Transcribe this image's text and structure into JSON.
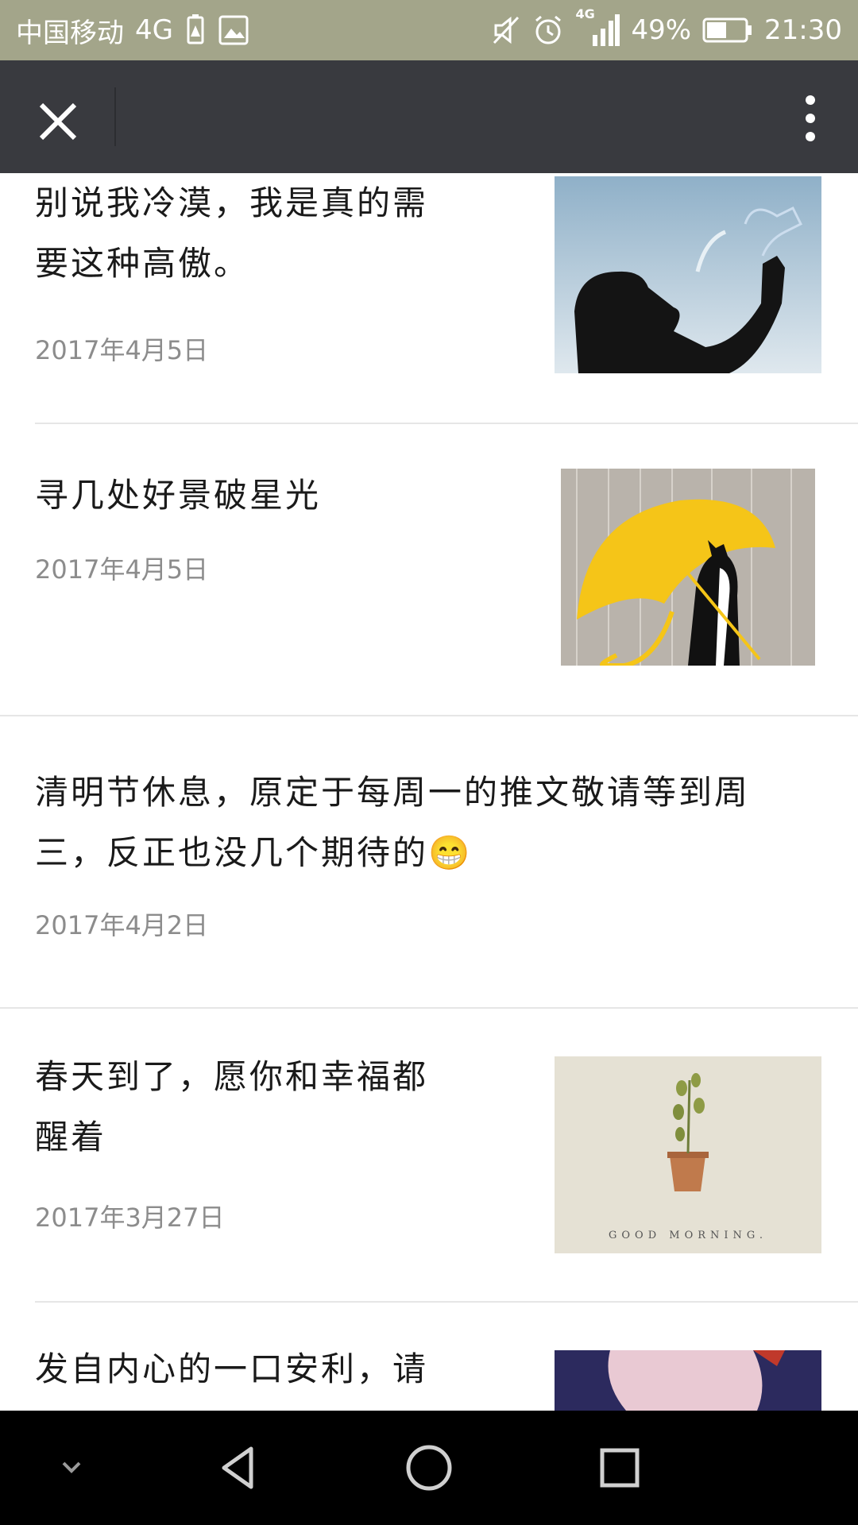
{
  "status_bar": {
    "carrier": "中国移动",
    "network": "4G",
    "signal_label": "4G",
    "battery": "49%",
    "time": "21:30",
    "icons": [
      "battery-saver-icon",
      "image-icon",
      "mute-icon",
      "alarm-icon",
      "signal-icon",
      "battery-icon"
    ]
  },
  "app_bar": {
    "close_icon": "close-icon",
    "more_icon": "more-vertical-icon"
  },
  "articles": [
    {
      "title_lines": [
        "别说我冷漠，我是真的需",
        "要这种高傲。"
      ],
      "date": "2017年4月5日",
      "thumb": "silhouette-drinking-image"
    },
    {
      "title_lines": [
        "寻几处好景破星光"
      ],
      "date": "2017年4月5日",
      "thumb": "cat-umbrella-image"
    },
    {
      "title_lines": [
        "清明节休息，原定于每周一的推文敬请等到周",
        "三，反正也没几个期待的😁"
      ],
      "date": "2017年4月2日"
    },
    {
      "title_lines": [
        "春天到了，愿你和幸福都",
        "醒着"
      ],
      "date": "2017年3月27日",
      "thumb": "potted-plant-image",
      "thumb_caption": "GOOD MORNING."
    },
    {
      "title_lines": [
        "发自内心的一口安利，请"
      ],
      "thumb": "illustration-image"
    }
  ],
  "nav_bar": {
    "icons": [
      "chevron-down-icon",
      "back-icon",
      "home-icon",
      "recents-icon"
    ]
  },
  "colors": {
    "status_bar": "#a3a58a",
    "app_bar": "#393a3f",
    "umbrella": "#f5c518"
  }
}
